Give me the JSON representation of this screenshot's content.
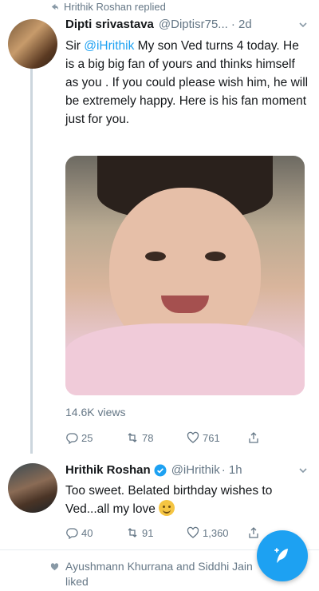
{
  "context": {
    "replied_label": "Hrithik Roshan replied",
    "icon": "reply-arrow-icon"
  },
  "tweet1": {
    "name": "Dipti srivastava",
    "handle": "@Diptisr75...",
    "time": "· 2d",
    "text_prefix": "Sir ",
    "mention": "@iHrithik",
    "text_body": " My son Ved turns 4 today. He is a big big fan of yours and thinks himself as you . If you could please wish him, he will be extremely happy. Here is his fan moment just for you.",
    "views": "14.6K views",
    "reply_count": "25",
    "retweet_count": "78",
    "like_count": "761"
  },
  "tweet2": {
    "name": "Hrithik Roshan",
    "handle": "@iHrithik",
    "time": "· 1h",
    "text": "Too sweet. Belated birthday wishes to Ved...all my love",
    "emoji": "hugging-face-emoji",
    "reply_count": "40",
    "retweet_count": "91",
    "like_count": "1,360"
  },
  "liked_context": {
    "text": "Ayushmann Khurrana and Siddhi Jain liked",
    "icon": "heart-icon"
  },
  "compose_button": {
    "icon": "compose-feather-icon"
  },
  "colors": {
    "accent": "#1da1f2",
    "muted": "#657786",
    "text": "#14171a",
    "line": "#ccd6dd"
  }
}
